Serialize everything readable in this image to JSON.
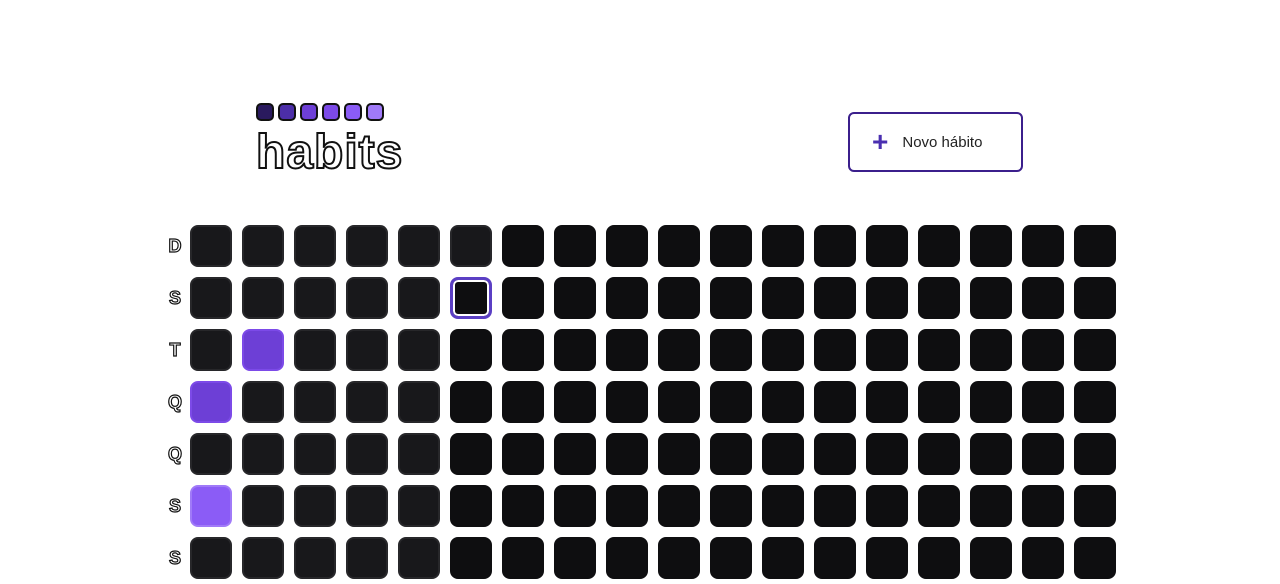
{
  "header": {
    "logo_text": "habits",
    "logo_colors": [
      "#2a1a5e",
      "#4c2ea8",
      "#6d3fd6",
      "#7c4ae8",
      "#8b5cf6",
      "#a07af8"
    ],
    "new_habit_label": "Novo hábito",
    "plus_icon": "plus-icon"
  },
  "week_days": [
    "D",
    "S",
    "T",
    "Q",
    "Q",
    "S",
    "S"
  ],
  "colors": {
    "empty": "#18181b",
    "future": "#0e0e10",
    "accent": "#6d3fd6",
    "accent_light": "#8b5cf6"
  },
  "summary": {
    "columns": 18,
    "past_columns": 5,
    "today": {
      "row": 1,
      "col": 5
    },
    "completed": [
      {
        "row": 2,
        "col": 1,
        "level": 1
      },
      {
        "row": 3,
        "col": 0,
        "level": 1
      },
      {
        "row": 5,
        "col": 0,
        "level": 2
      }
    ]
  }
}
